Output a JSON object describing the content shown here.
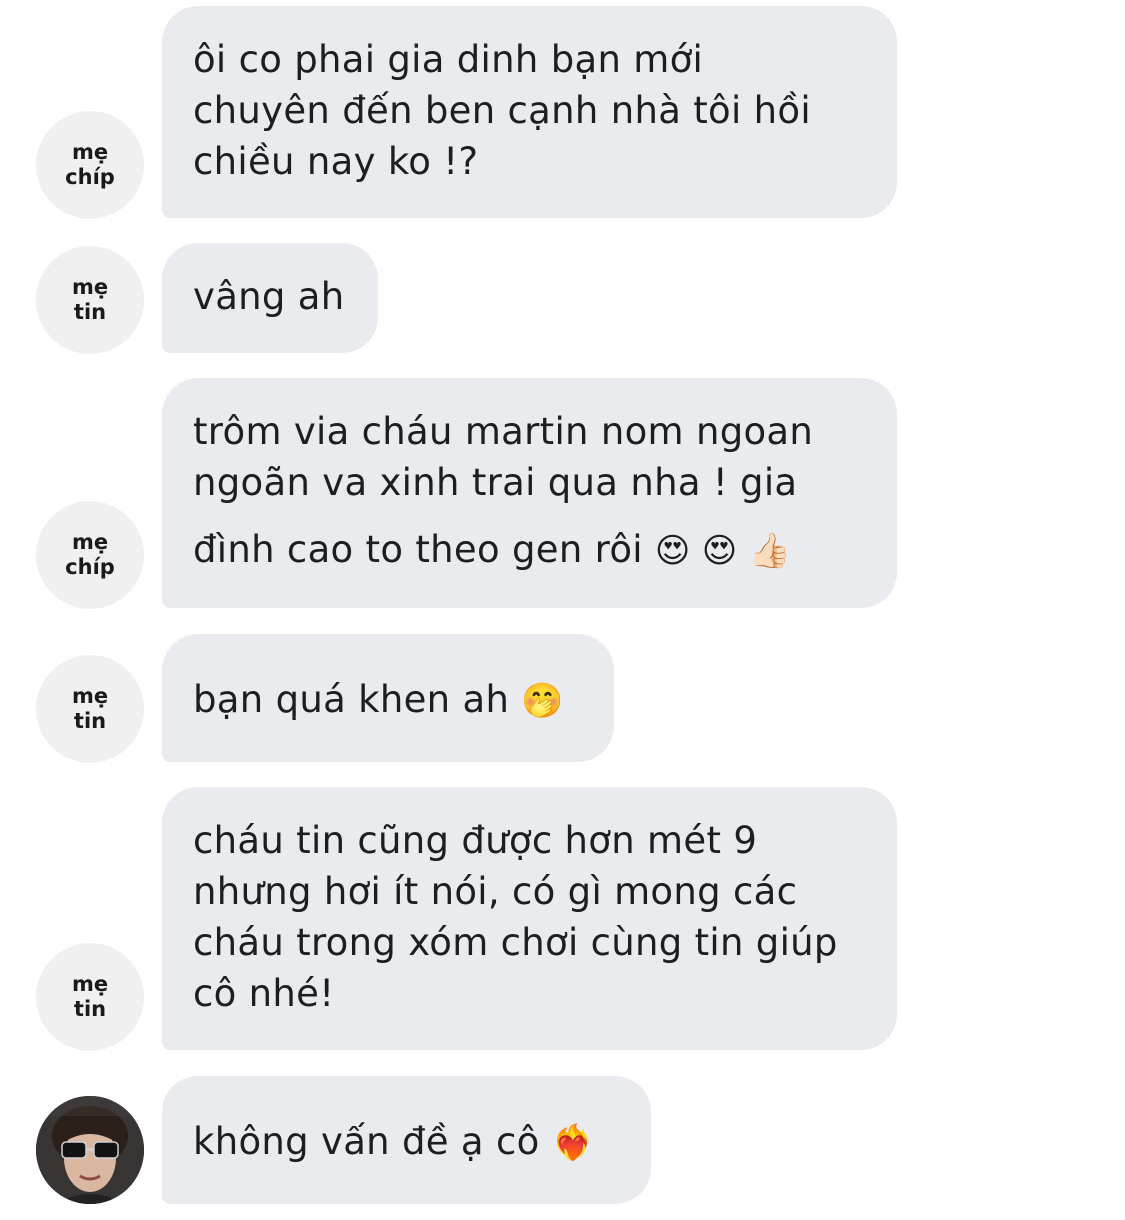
{
  "messages": [
    {
      "sender": "mẹ chíp",
      "avatar_lines": [
        "mẹ",
        "chíp"
      ],
      "lines": [
        "ôi co phai gia dinh bạn mới",
        "chuyên đến ben cạnh nhà tôi hồi",
        "chiều nay ko !?"
      ]
    },
    {
      "sender": "mẹ tin",
      "avatar_lines": [
        "mẹ",
        "tin"
      ],
      "lines": [
        "vâng ah"
      ]
    },
    {
      "sender": "mẹ chíp",
      "avatar_lines": [
        "mẹ",
        "chíp"
      ],
      "lines": [
        "trôm via cháu martin nom ngoan",
        "ngoãn va xinh trai qua nha ! gia",
        "đình cao to theo gen rôi"
      ],
      "emoji": "😍 😍 👍🏻"
    },
    {
      "sender": "mẹ tin",
      "avatar_lines": [
        "mẹ",
        "tin"
      ],
      "lines": [
        "bạn quá khen ah"
      ],
      "emoji": "🤭"
    },
    {
      "sender": "mẹ tin",
      "avatar_lines": [
        "mẹ",
        "tin"
      ],
      "lines": [
        "cháu tin cũng được hơn mét 9",
        "nhưng hơi ít nói, có gì mong các",
        "cháu trong xóm chơi cùng tin giúp",
        "cô nhé!"
      ]
    },
    {
      "sender": "user-photo",
      "lines": [
        "không vấn đề ạ cô"
      ],
      "emoji": "❤️‍🔥"
    }
  ],
  "colors": {
    "bubble": "#e9ebef",
    "avatar_bg": "#f0f0f0",
    "text": "#1c1e21"
  }
}
